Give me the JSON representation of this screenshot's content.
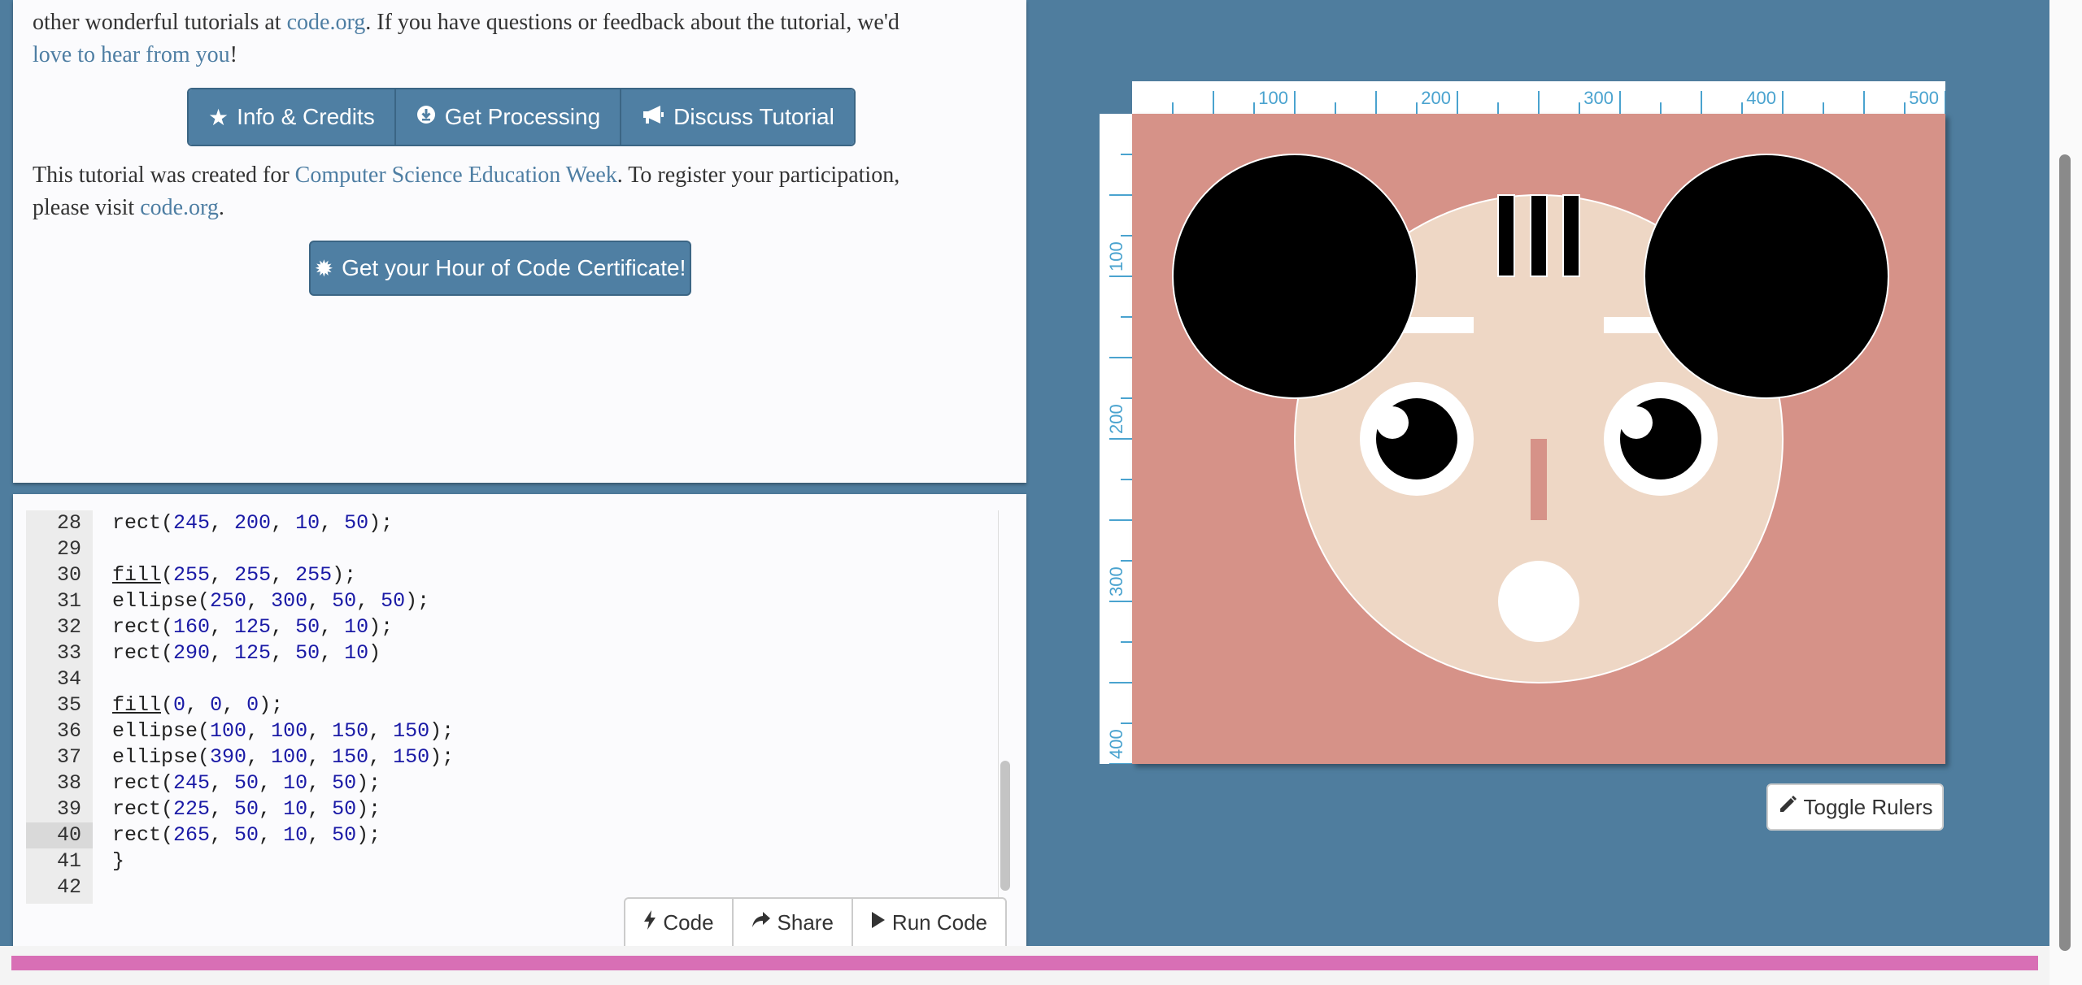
{
  "intro": {
    "line1_pre": "other wonderful tutorials at ",
    "line1_link": "code.org",
    "line1_post": ". If you have questions or feedback about the tutorial, we'd",
    "line2_link": "love to hear from you",
    "line2_post": "!"
  },
  "buttons": {
    "info": "Info & Credits",
    "processing": "Get Processing",
    "discuss": "Discuss Tutorial"
  },
  "register": {
    "line1_pre": "This tutorial was created for ",
    "line1_link": "Computer Science Education Week",
    "line1_post": ". To register your participation,",
    "line2_pre": "please visit ",
    "line2_link": "code.org",
    "line2_post": "."
  },
  "certificate_label": "Get your Hour of Code Certificate!",
  "code": {
    "lines": [
      {
        "n": "28",
        "text": "rect(245, 200, 10, 50);"
      },
      {
        "n": "29",
        "text": ""
      },
      {
        "n": "30",
        "text": "fill(255, 255, 255);"
      },
      {
        "n": "31",
        "text": "ellipse(250, 300, 50, 50);"
      },
      {
        "n": "32",
        "text": "rect(160, 125, 50, 10);"
      },
      {
        "n": "33",
        "text": "rect(290, 125, 50, 10)"
      },
      {
        "n": "34",
        "text": ""
      },
      {
        "n": "35",
        "text": "fill(0, 0, 0);"
      },
      {
        "n": "36",
        "text": "ellipse(100, 100, 150, 150);"
      },
      {
        "n": "37",
        "text": "ellipse(390, 100, 150, 150);"
      },
      {
        "n": "38",
        "text": "rect(245, 50, 10, 50);"
      },
      {
        "n": "39",
        "text": "rect(225, 50, 10, 50);"
      },
      {
        "n": "40",
        "text": "rect(265, 50, 10, 50);"
      },
      {
        "n": "41",
        "text": "}"
      },
      {
        "n": "42",
        "text": ""
      }
    ],
    "active_line": "40"
  },
  "editor_buttons": {
    "code": "Code",
    "share": "Share",
    "run": "Run Code"
  },
  "rulers": {
    "horizontal_labels": [
      "100",
      "200",
      "300",
      "400",
      "500"
    ],
    "vertical_labels": [
      "100",
      "200",
      "300",
      "400"
    ]
  },
  "toggle_rulers_label": "Toggle Rulers",
  "colors": {
    "page_background": "#4f7d9e",
    "button_blue": "#4f7fa3",
    "link": "#4e7ea3",
    "canvas_background": "#d69288",
    "face": "#eed7c5",
    "progress": "#d86fb5",
    "ruler_text": "#4aa3cf"
  }
}
